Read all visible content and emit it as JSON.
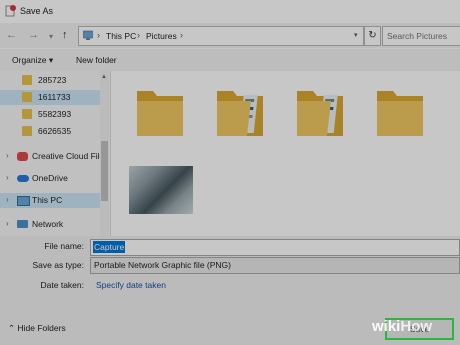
{
  "window": {
    "title": "Save As"
  },
  "address": {
    "crumbs": [
      "This PC",
      "Pictures"
    ]
  },
  "search": {
    "placeholder": "Search Pictures"
  },
  "toolbar": {
    "organize_label": "Organize ▾",
    "new_folder_label": "New folder"
  },
  "sidebar": {
    "items": [
      {
        "label": "285723",
        "icon": "folder-icon"
      },
      {
        "label": "1611733",
        "icon": "folder-icon",
        "selected": true
      },
      {
        "label": "5582393",
        "icon": "folder-icon"
      },
      {
        "label": "6626535",
        "icon": "folder-icon"
      },
      {
        "label": "Creative Cloud File",
        "icon": "creative-cloud-icon"
      },
      {
        "label": "OneDrive",
        "icon": "onedrive-icon"
      },
      {
        "label": "This PC",
        "icon": "computer-icon",
        "selected": true
      },
      {
        "label": "Network",
        "icon": "network-icon"
      }
    ]
  },
  "form": {
    "file_name_label": "File name:",
    "file_name_value": "Capture",
    "save_as_type_label": "Save as type:",
    "save_as_type_value": "Portable Network Graphic file (PNG)",
    "date_taken_label": "Date taken:",
    "date_taken_link": "Specify date taken"
  },
  "footer": {
    "hide_folders_label": "Hide Folders",
    "save_label": "Save"
  },
  "watermark": {
    "text_a": "wiki",
    "text_b": "How"
  },
  "colors": {
    "folder": "#e8c04a",
    "highlight": "#0078d7",
    "save_outline": "#2ef048"
  }
}
